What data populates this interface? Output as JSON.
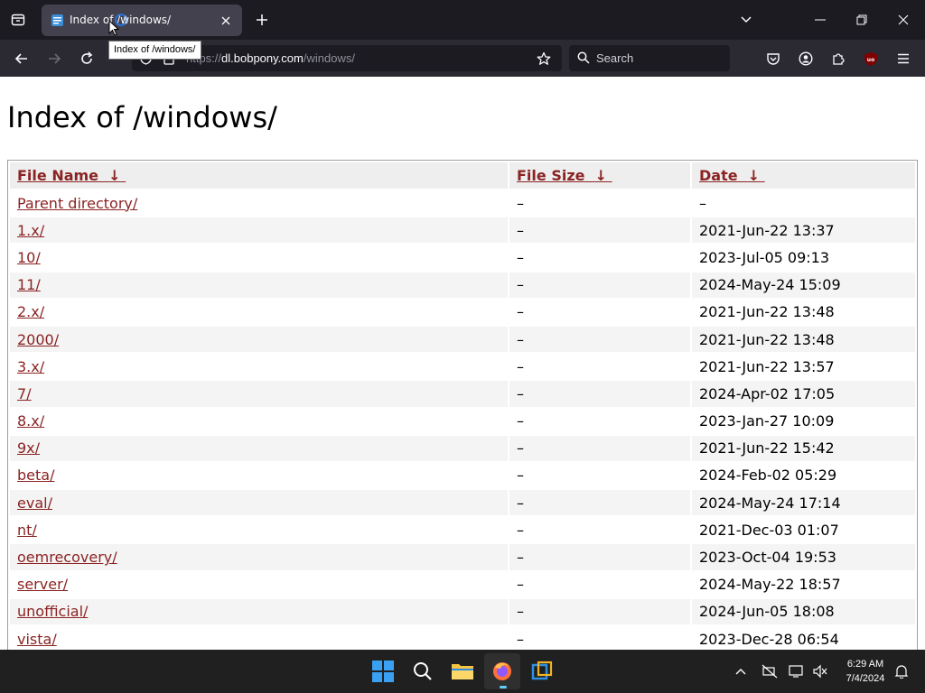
{
  "browser": {
    "tab": {
      "title": "Index of /windows/"
    },
    "tooltip": "Index of /windows/",
    "url": {
      "scheme": "https://",
      "host": "dl.bobpony.com",
      "path": "/windows/"
    },
    "search": {
      "placeholder": "Search"
    }
  },
  "page": {
    "title": "Index of /windows/",
    "table": {
      "headers": {
        "name": "File Name",
        "size": "File Size",
        "date": "Date"
      },
      "sort_arrow": "↓",
      "rows": [
        {
          "name": "Parent directory/",
          "size": "–",
          "date": "–"
        },
        {
          "name": "1.x/",
          "size": "–",
          "date": "2021-Jun-22 13:37"
        },
        {
          "name": "10/",
          "size": "–",
          "date": "2023-Jul-05 09:13"
        },
        {
          "name": "11/",
          "size": "–",
          "date": "2024-May-24 15:09"
        },
        {
          "name": "2.x/",
          "size": "–",
          "date": "2021-Jun-22 13:48"
        },
        {
          "name": "2000/",
          "size": "–",
          "date": "2021-Jun-22 13:48"
        },
        {
          "name": "3.x/",
          "size": "–",
          "date": "2021-Jun-22 13:57"
        },
        {
          "name": "7/",
          "size": "–",
          "date": "2024-Apr-02 17:05"
        },
        {
          "name": "8.x/",
          "size": "–",
          "date": "2023-Jan-27 10:09"
        },
        {
          "name": "9x/",
          "size": "–",
          "date": "2021-Jun-22 15:42"
        },
        {
          "name": "beta/",
          "size": "–",
          "date": "2024-Feb-02 05:29"
        },
        {
          "name": "eval/",
          "size": "–",
          "date": "2024-May-24 17:14"
        },
        {
          "name": "nt/",
          "size": "–",
          "date": "2021-Dec-03 01:07"
        },
        {
          "name": "oemrecovery/",
          "size": "–",
          "date": "2023-Oct-04 19:53"
        },
        {
          "name": "server/",
          "size": "–",
          "date": "2024-May-22 18:57"
        },
        {
          "name": "unofficial/",
          "size": "–",
          "date": "2024-Jun-05 18:08"
        },
        {
          "name": "vista/",
          "size": "–",
          "date": "2023-Dec-28 06:54"
        }
      ]
    }
  },
  "taskbar": {
    "time": "6:29 AM",
    "date": "7/4/2024",
    "apps": [
      "windows-start-icon",
      "search-icon",
      "file-explorer-icon",
      "firefox-icon",
      "virtualbox-icon"
    ]
  },
  "colors": {
    "link": "#8b2323",
    "chrome_dark": "#1c1b22",
    "toolbar": "#2b2a33",
    "taskbar": "#202020",
    "accent": "#60cdff"
  }
}
